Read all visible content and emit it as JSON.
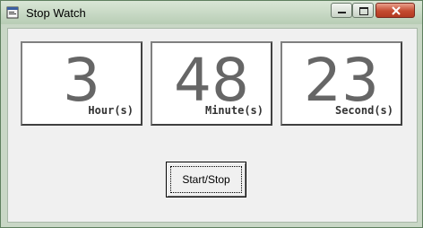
{
  "window": {
    "title": "Stop Watch",
    "icon": "stopwatch-app-icon",
    "controls": {
      "minimize_icon": "minimize-icon",
      "maximize_icon": "maximize-icon",
      "close_icon": "close-icon"
    },
    "colors": {
      "close": "#c44a30",
      "titlebar": "#c9d7c6"
    }
  },
  "timer": {
    "hours": {
      "value": "3",
      "unit": "Hour(s)"
    },
    "minutes": {
      "value": "48",
      "unit": "Minute(s)"
    },
    "seconds": {
      "value": "23",
      "unit": "Second(s)"
    }
  },
  "controls": {
    "start_stop_label": "Start/Stop"
  }
}
